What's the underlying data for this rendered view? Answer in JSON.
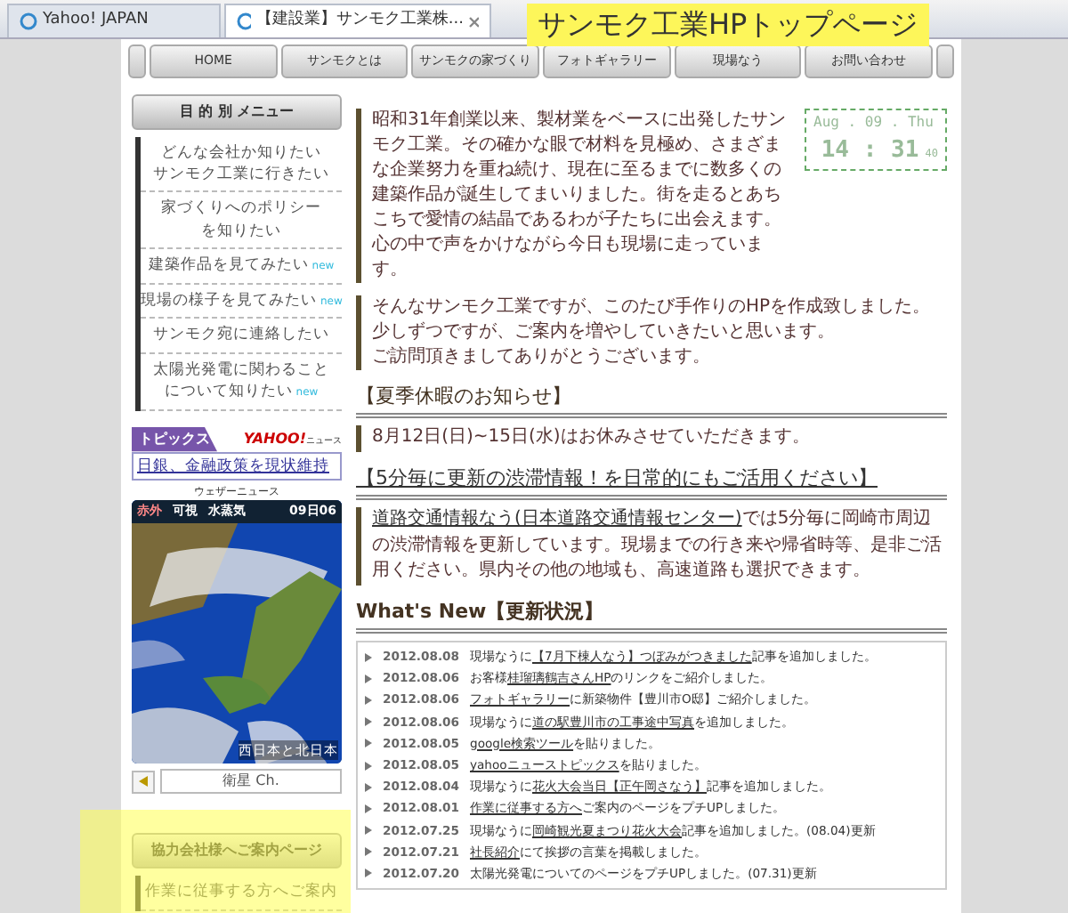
{
  "browser": {
    "tabs": [
      {
        "title": "Yahoo! JAPAN",
        "selected": false
      },
      {
        "title": "【建設業】サンモク工業株...",
        "selected": true
      }
    ]
  },
  "annotations": [
    {
      "kind": "label",
      "text": "サンモク工業HPトップページ"
    },
    {
      "kind": "highlight"
    }
  ],
  "nav": [
    "HOME",
    "サンモクとは",
    "サンモクの家づくり",
    "フォトギャラリー",
    "現場なう",
    "お問い合わせ"
  ],
  "sidebar": {
    "menu_title": "目 的 別 メニュー",
    "menu_items": [
      {
        "lines": [
          "どんな会社か知りたい",
          "サンモク工業に行きたい"
        ]
      },
      {
        "lines": [
          "家づくりへのポリシー",
          "を知りたい"
        ]
      },
      {
        "lines": [
          "建築作品を見てみたい"
        ],
        "badge": "new"
      },
      {
        "lines": [
          "現場の様子を見てみたい"
        ],
        "badge": "new"
      },
      {
        "lines": [
          "サンモク宛に連絡したい"
        ]
      },
      {
        "lines": [
          "太陽光発電に関わること",
          "について知りたい"
        ],
        "badge": "new"
      }
    ],
    "topics": {
      "tab": "トピックス",
      "logo": "YAHOO!",
      "logo_label": "ニュース",
      "headline": "日銀、金融政策を現状維持"
    },
    "weather": {
      "title": "ウェザーニュース",
      "tabs": [
        {
          "label": "赤外",
          "selected": true
        },
        {
          "label": "可視",
          "selected": false
        },
        {
          "label": "水蒸気",
          "selected": false
        }
      ],
      "time": "09日06",
      "caption": "西日本と北日本",
      "channel": "衛星 Ch."
    },
    "partner": {
      "title": "協力会社様へご案内ページ",
      "items": [
        "作業に従事する方へご案内"
      ]
    }
  },
  "clock": {
    "date": "Aug . 09 . Thu",
    "time": "14 : 31",
    "seconds": "40"
  },
  "intro": [
    {
      "lines": [
        "昭和31年創業以来、製材業をベースに出発したサンモク工業。その確かな眼で材料を見極め、さまざまな企業努力を重ね続け、現在に至るまでに数多くの建築作品が誕生してまいりました。街を走るとあちこちで愛情の結晶であるわが子たちに出会えます。心の中で声をかけながら今日も現場に走っています。"
      ]
    },
    {
      "lines": [
        "そんなサンモク工業ですが、このたび手作りのHPを作成致しました。少しずつですが、ご案内を増やしていきたいと思います。",
        "ご訪問頂きましてありがとうございます。"
      ]
    }
  ],
  "notices": [
    {
      "title": "【夏季休暇のお知らせ】",
      "title_link": false,
      "parts": [
        {
          "text": "8月12日(日)~15日(水)はお休みさせていただきます。",
          "link": false
        }
      ]
    },
    {
      "title": "【5分毎に更新の渋滞情報！を日常的にもご活用ください】",
      "title_link": true,
      "parts": [
        {
          "text": "道路交通情報なう(日本道路交通情報センター)",
          "link": true
        },
        {
          "text": "では5分毎に岡崎市周辺の渋滞情報を更新しています。現場までの行き来や帰省時等、是非ご活用ください。県内その他の地域も、高速道路も選択できます。",
          "link": false
        }
      ]
    }
  ],
  "news": {
    "title": "What's New【更新状況】",
    "items": [
      {
        "date": "2012.08.08",
        "parts": [
          {
            "text": "現場なうに",
            "link": false
          },
          {
            "text": "【7月下棟人なう】つぼみがつきました",
            "link": true
          },
          {
            "text": "記事を追加しました。",
            "link": false
          }
        ]
      },
      {
        "date": "2012.08.06",
        "parts": [
          {
            "text": "お客様",
            "link": false
          },
          {
            "text": "桂瑠璃鶴吉さんHP",
            "link": true
          },
          {
            "text": "のリンクをご紹介しました。",
            "link": false
          }
        ]
      },
      {
        "date": "2012.08.06",
        "parts": [
          {
            "text": "フォトギャラリー",
            "link": true
          },
          {
            "text": "に新築物件【豊川市O邸】ご紹介しました。",
            "link": false
          }
        ]
      },
      {
        "date": "2012.08.06",
        "parts": [
          {
            "text": "現場なうに",
            "link": false
          },
          {
            "text": "道の駅豊川市の工事途中写真",
            "link": true
          },
          {
            "text": "を追加しました。",
            "link": false
          }
        ]
      },
      {
        "date": "2012.08.05",
        "parts": [
          {
            "text": "google検索ツール",
            "link": true
          },
          {
            "text": "を貼りました。",
            "link": false
          }
        ]
      },
      {
        "date": "2012.08.05",
        "parts": [
          {
            "text": "yahooニューストピックス",
            "link": true
          },
          {
            "text": "を貼りました。",
            "link": false
          }
        ]
      },
      {
        "date": "2012.08.04",
        "parts": [
          {
            "text": "現場なうに",
            "link": false
          },
          {
            "text": "花火大会当日【正午岡さなう】",
            "link": true
          },
          {
            "text": "記事を追加しました。",
            "link": false
          }
        ]
      },
      {
        "date": "2012.08.01",
        "parts": [
          {
            "text": "作業に従事する方へ",
            "link": true
          },
          {
            "text": "ご案内のページをプチUPしました。",
            "link": false
          }
        ]
      },
      {
        "date": "2012.07.25",
        "parts": [
          {
            "text": "現場なうに",
            "link": false
          },
          {
            "text": "岡崎観光夏まつり花火大会",
            "link": true
          },
          {
            "text": "記事を追加しました。(08.04)更新",
            "link": false
          }
        ]
      },
      {
        "date": "2012.07.21",
        "parts": [
          {
            "text": "社長紹介",
            "link": true
          },
          {
            "text": "にて挨拶の言葉を掲載しました。",
            "link": false
          }
        ]
      },
      {
        "date": "2012.07.20",
        "parts": [
          {
            "text": "太陽光発電についてのページをプチUPしました。(07.31)更新",
            "link": false
          }
        ]
      }
    ]
  }
}
